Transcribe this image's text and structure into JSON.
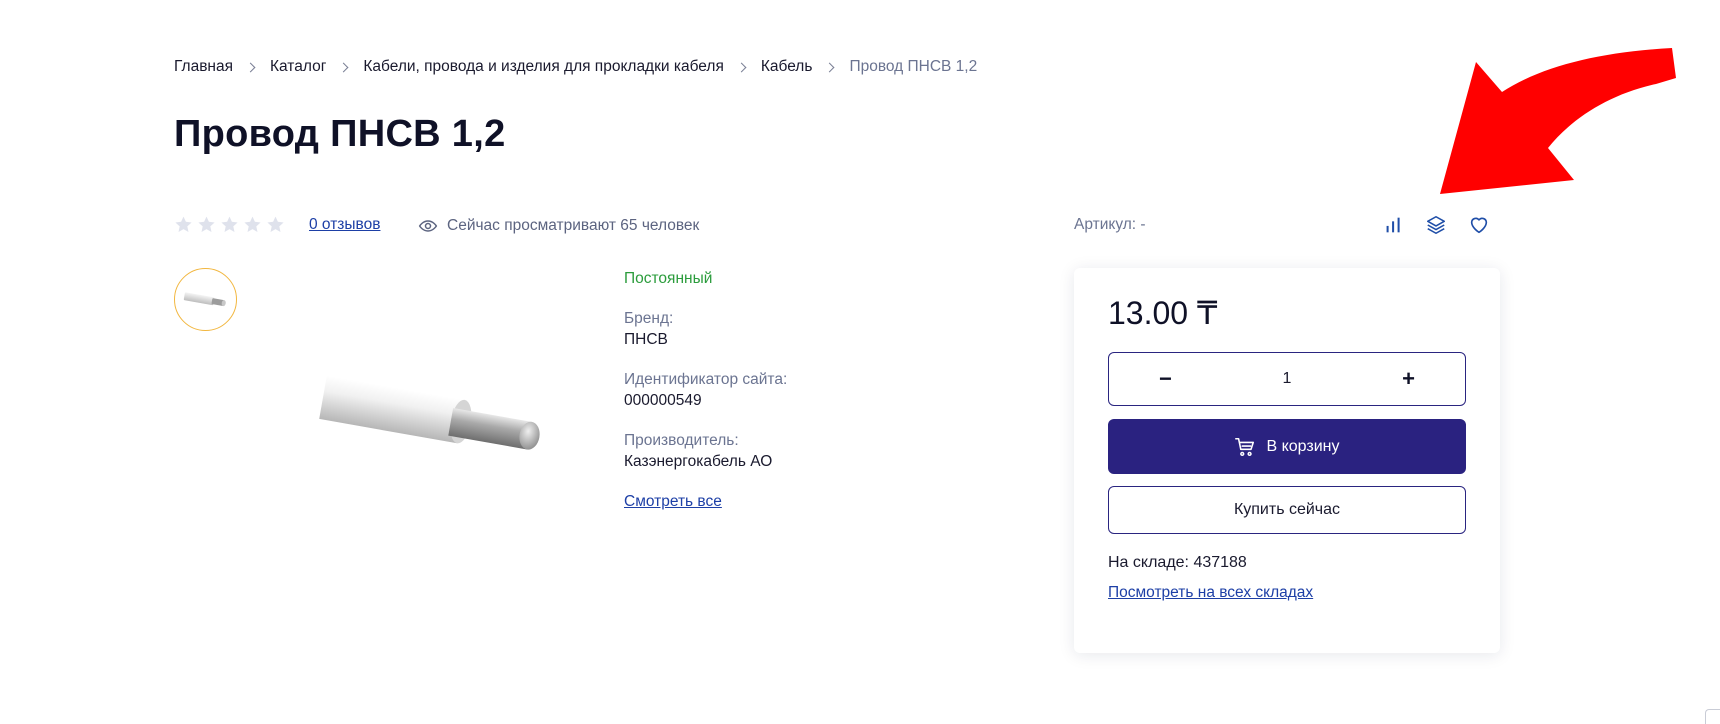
{
  "breadcrumb": {
    "items": [
      "Главная",
      "Каталог",
      "Кабели, провода и изделия для прокладки кабеля",
      "Кабель"
    ],
    "current": "Провод ПНСВ 1,2"
  },
  "product": {
    "title": "Провод ПНСВ 1,2",
    "rating": 0,
    "rating_max": 5,
    "reviews_label": "0 отзывов",
    "viewers_label": "Сейчас просматривают 65 человек",
    "sku_label": "Артикул: -"
  },
  "properties": {
    "status": "Постоянный",
    "brand_label": "Бренд:",
    "brand_value": "ПНСВ",
    "site_id_label": "Идентификатор сайта:",
    "site_id_value": "000000549",
    "manufacturer_label": "Производитель:",
    "manufacturer_value": "Казэнергокабель АО",
    "see_all_label": "Смотреть все"
  },
  "purchase": {
    "price": "13.00 ₸",
    "quantity": "1",
    "minus_symbol": "−",
    "plus_symbol": "+",
    "cart_label": "В корзину",
    "buy_now_label": "Купить сейчас",
    "stock_label": "На складе: 437188",
    "stock_link_label": "Посмотреть на всех складах"
  },
  "icons": [
    "compare-icon",
    "layers-icon",
    "heart-icon",
    "eye-icon",
    "star-icon",
    "cart-icon"
  ],
  "colors": {
    "primary": "#2a2280",
    "link": "#1d3fa6",
    "status_green": "#2b9c3c",
    "arrow_red": "#ff0000",
    "thumb_border": "#f2b740"
  }
}
